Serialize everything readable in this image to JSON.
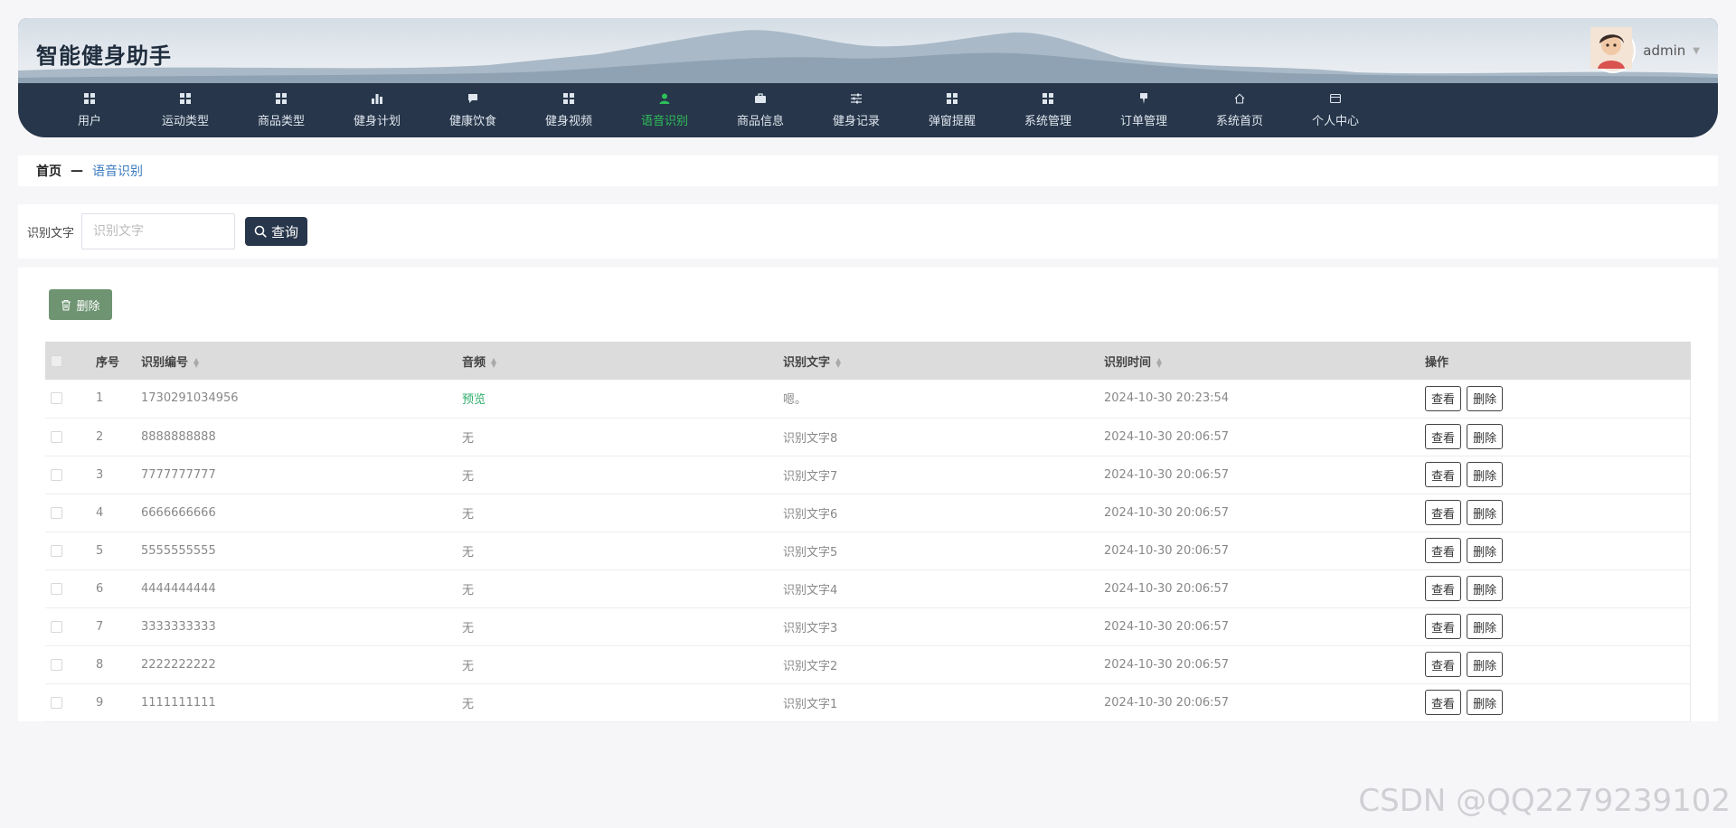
{
  "app": {
    "title": "智能健身助手"
  },
  "user": {
    "name": "admin"
  },
  "nav": [
    {
      "label": "用户",
      "icon": "grid-icon"
    },
    {
      "label": "运动类型",
      "icon": "grid-icon"
    },
    {
      "label": "商品类型",
      "icon": "grid-icon"
    },
    {
      "label": "健身计划",
      "icon": "bar-chart-icon"
    },
    {
      "label": "健康饮食",
      "icon": "chat-icon"
    },
    {
      "label": "健身视频",
      "icon": "grid-icon"
    },
    {
      "label": "语音识别",
      "icon": "user-icon",
      "active": true
    },
    {
      "label": "商品信息",
      "icon": "briefcase-icon"
    },
    {
      "label": "健身记录",
      "icon": "sliders-icon"
    },
    {
      "label": "弹窗提醒",
      "icon": "grid-icon"
    },
    {
      "label": "系统管理",
      "icon": "grid-icon"
    },
    {
      "label": "订单管理",
      "icon": "pin-icon"
    },
    {
      "label": "系统首页",
      "icon": "home-icon"
    },
    {
      "label": "个人中心",
      "icon": "card-icon"
    }
  ],
  "breadcrumb": {
    "home": "首页",
    "separator": "—",
    "current": "语音识别"
  },
  "search": {
    "label": "识别文字",
    "placeholder": "识别文字",
    "button": "查询"
  },
  "toolbar": {
    "delete_label": "删除"
  },
  "table": {
    "headers": {
      "index": "序号",
      "code": "识别编号",
      "audio": "音频",
      "text": "识别文字",
      "time": "识别时间",
      "ops": "操作"
    },
    "view_label": "查看",
    "delete_label": "删除",
    "rows": [
      {
        "index": "1",
        "code": "1730291034956",
        "audio": "预览",
        "audio_link": true,
        "text": "嗯。",
        "time": "2024-10-30 20:23:54"
      },
      {
        "index": "2",
        "code": "8888888888",
        "audio": "无",
        "text": "识别文字8",
        "time": "2024-10-30 20:06:57"
      },
      {
        "index": "3",
        "code": "7777777777",
        "audio": "无",
        "text": "识别文字7",
        "time": "2024-10-30 20:06:57"
      },
      {
        "index": "4",
        "code": "6666666666",
        "audio": "无",
        "text": "识别文字6",
        "time": "2024-10-30 20:06:57"
      },
      {
        "index": "5",
        "code": "5555555555",
        "audio": "无",
        "text": "识别文字5",
        "time": "2024-10-30 20:06:57"
      },
      {
        "index": "6",
        "code": "4444444444",
        "audio": "无",
        "text": "识别文字4",
        "time": "2024-10-30 20:06:57"
      },
      {
        "index": "7",
        "code": "3333333333",
        "audio": "无",
        "text": "识别文字3",
        "time": "2024-10-30 20:06:57"
      },
      {
        "index": "8",
        "code": "2222222222",
        "audio": "无",
        "text": "识别文字2",
        "time": "2024-10-30 20:06:57"
      },
      {
        "index": "9",
        "code": "1111111111",
        "audio": "无",
        "text": "识别文字1",
        "time": "2024-10-30 20:06:57"
      }
    ]
  },
  "watermark": "CSDN @QQ2279239102",
  "colors": {
    "nav_bg": "#27364a",
    "active": "#2fbf5a",
    "delete_btn": "#6f9472",
    "link": "#2fae6c"
  }
}
